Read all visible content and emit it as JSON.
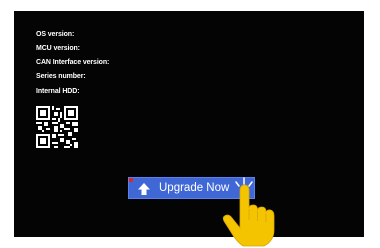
{
  "info": {
    "os_version_label": "OS version:",
    "mcu_version_label": "MCU version:",
    "can_interface_version_label": "CAN Interface version:",
    "series_number_label": "Series number:",
    "internal_hdd_label": "Internal HDD:"
  },
  "qr": {
    "icon": "qr-code-icon"
  },
  "upgrade_button": {
    "label": "Upgrade Now",
    "icon": "upload-arrow-icon",
    "color": "#3f68d6"
  },
  "cursor": {
    "icon": "hand-pointer-icon",
    "color": "#f5c400"
  },
  "colors": {
    "screen_background": "#040404",
    "text": "#ffffff"
  }
}
